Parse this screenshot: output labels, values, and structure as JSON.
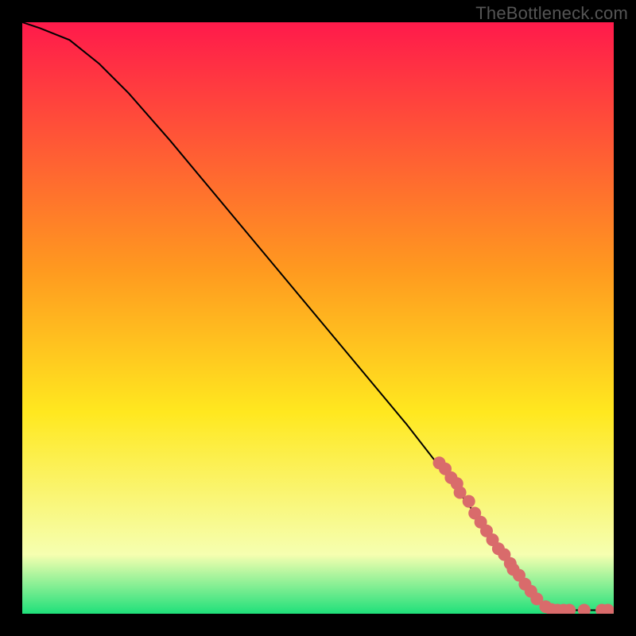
{
  "watermark": "TheBottleneck.com",
  "chart_data": {
    "type": "line",
    "title": "",
    "xlabel": "",
    "ylabel": "",
    "xlim": [
      0,
      100
    ],
    "ylim": [
      0,
      100
    ],
    "curve": [
      {
        "x": 0,
        "y": 100
      },
      {
        "x": 3,
        "y": 99
      },
      {
        "x": 8,
        "y": 97
      },
      {
        "x": 13,
        "y": 93
      },
      {
        "x": 18,
        "y": 88
      },
      {
        "x": 25,
        "y": 80
      },
      {
        "x": 35,
        "y": 68
      },
      {
        "x": 45,
        "y": 56
      },
      {
        "x": 55,
        "y": 44
      },
      {
        "x": 65,
        "y": 32
      },
      {
        "x": 72,
        "y": 23
      },
      {
        "x": 78,
        "y": 15
      },
      {
        "x": 83,
        "y": 8
      },
      {
        "x": 86,
        "y": 4
      },
      {
        "x": 88,
        "y": 1.5
      },
      {
        "x": 90,
        "y": 0.6
      },
      {
        "x": 100,
        "y": 0.6
      }
    ],
    "markers": [
      {
        "x": 70.5,
        "y": 25.5
      },
      {
        "x": 71.5,
        "y": 24.5
      },
      {
        "x": 72.5,
        "y": 23.0
      },
      {
        "x": 73.5,
        "y": 22.0
      },
      {
        "x": 74.0,
        "y": 20.5
      },
      {
        "x": 75.5,
        "y": 19.0
      },
      {
        "x": 76.5,
        "y": 17.0
      },
      {
        "x": 77.5,
        "y": 15.5
      },
      {
        "x": 78.5,
        "y": 14.0
      },
      {
        "x": 79.5,
        "y": 12.5
      },
      {
        "x": 80.5,
        "y": 11.0
      },
      {
        "x": 81.5,
        "y": 10.0
      },
      {
        "x": 82.5,
        "y": 8.5
      },
      {
        "x": 83.0,
        "y": 7.5
      },
      {
        "x": 84.0,
        "y": 6.5
      },
      {
        "x": 85.0,
        "y": 5.0
      },
      {
        "x": 86.0,
        "y": 3.8
      },
      {
        "x": 87.0,
        "y": 2.5
      },
      {
        "x": 88.5,
        "y": 1.2
      },
      {
        "x": 89.5,
        "y": 0.7
      },
      {
        "x": 90.5,
        "y": 0.6
      },
      {
        "x": 91.5,
        "y": 0.6
      },
      {
        "x": 92.5,
        "y": 0.6
      },
      {
        "x": 95.0,
        "y": 0.6
      },
      {
        "x": 98.0,
        "y": 0.6
      },
      {
        "x": 99.0,
        "y": 0.6
      }
    ],
    "gradient_top": "#ff1a4b",
    "gradient_bottom": "#1fe07a",
    "gradient_mid1": "#ff9a1f",
    "gradient_mid2": "#ffe81f",
    "gradient_mid3": "#f6ffb0",
    "marker_color": "#d96b6b",
    "line_color": "#000000"
  }
}
